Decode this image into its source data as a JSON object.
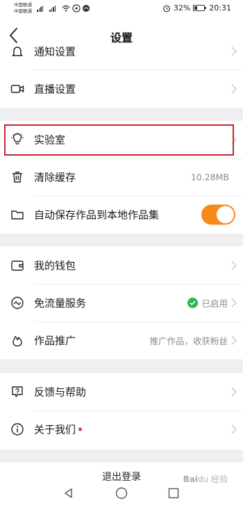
{
  "status_bar": {
    "carrier_line1": "中国联通",
    "carrier_line2": "中国联通",
    "battery": "32%",
    "time": "20:31"
  },
  "header": {
    "title": "设置"
  },
  "groups": {
    "group1": [
      {
        "label": "通知设置",
        "icon": "bell-icon"
      },
      {
        "label": "直播设置",
        "icon": "video-camera-icon"
      }
    ],
    "group2": [
      {
        "label": "实验室",
        "icon": "lightbulb-icon"
      },
      {
        "label": "清除缓存",
        "icon": "trash-icon",
        "value": "10.28MB"
      },
      {
        "label": "自动保存作品到本地作品集",
        "icon": "folder-icon",
        "toggle_on": true
      }
    ],
    "group3": [
      {
        "label": "我的钱包",
        "icon": "wallet-icon"
      },
      {
        "label": "免流量服务",
        "icon": "data-wave-icon",
        "status": "已启用"
      },
      {
        "label": "作品推广",
        "icon": "flame-icon",
        "value": "推广作品，收获粉丝"
      }
    ],
    "group4": [
      {
        "label": "反馈与帮助",
        "icon": "question-icon"
      },
      {
        "label": "关于我们",
        "icon": "info-icon",
        "has_dot": true
      }
    ]
  },
  "logout_label": "退出登录",
  "colors": {
    "accent": "#f58a17",
    "highlight": "#c3262e",
    "enabled": "#2fb54a",
    "dot": "#e8323a"
  },
  "watermark": {
    "brand": "Bai",
    "suffix": "经验",
    "icon_text": "du"
  }
}
